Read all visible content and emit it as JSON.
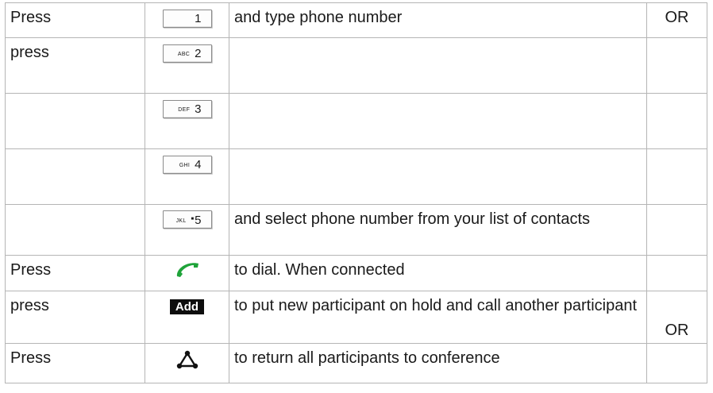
{
  "rows": [
    {
      "action": "Press",
      "key": {
        "type": "keypad",
        "digit": "1",
        "letters": ""
      },
      "description": "and type phone number",
      "note": "OR"
    },
    {
      "action": "press",
      "key": {
        "type": "keypad",
        "digit": "2",
        "letters": "ABC"
      },
      "description": "",
      "note": ""
    },
    {
      "action": "",
      "key": {
        "type": "keypad",
        "digit": "3",
        "letters": "DEF"
      },
      "description": "",
      "note": ""
    },
    {
      "action": "",
      "key": {
        "type": "keypad",
        "digit": "4",
        "letters": "GHI"
      },
      "description": "",
      "note": ""
    },
    {
      "action": "",
      "key": {
        "type": "keypad",
        "digit": "5",
        "letters": "JKL"
      },
      "description": "and select phone number from your list of contacts",
      "note": ""
    },
    {
      "action": "Press",
      "key": {
        "type": "icon",
        "icon": "phone-handset-icon",
        "color": "#1fa33a"
      },
      "description": "to dial. When connected",
      "note": ""
    },
    {
      "action": "press",
      "key": {
        "type": "softkey",
        "label": "Add"
      },
      "description": "to put new participant on hold and call another participant",
      "note": "OR"
    },
    {
      "action": "Press",
      "key": {
        "type": "icon",
        "icon": "conference-icon"
      },
      "description": "to return all participants to conference",
      "note": ""
    }
  ]
}
